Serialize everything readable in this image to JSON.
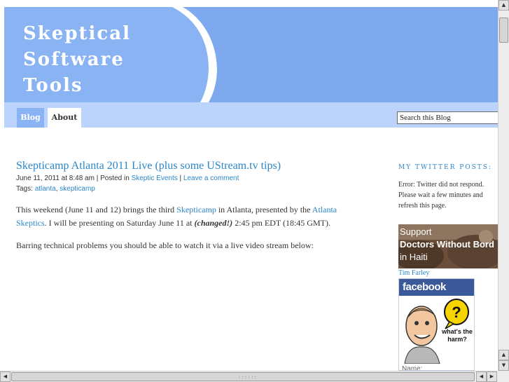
{
  "site": {
    "title": "Skeptical Software\nTools"
  },
  "nav": {
    "tabs": [
      "Blog",
      "About"
    ],
    "search_value": "Search this Blog"
  },
  "post": {
    "title": "Skepticamp Atlanta 2011 Live (plus some UStream.tv tips)",
    "date": "June 11, 2011 at 8:48 am",
    "posted_in_label": " | Posted in ",
    "category": "Skeptic Events",
    "sep": " | ",
    "comment_link": "Leave a comment",
    "tags_label": "Tags: ",
    "tags": [
      "atlanta",
      "skepticamp"
    ],
    "tags_sep": ", ",
    "p1_a": "This weekend (June 11 and 12) brings the third ",
    "p1_link1": "Skepticamp",
    "p1_b": " in Atlanta, presented by the ",
    "p1_link2": "Atlanta Skeptics",
    "p1_c": ". I will be presenting on Saturday June 11 at ",
    "p1_em": "(changed!)",
    "p1_d": " 2:45 pm EDT (18:45 GMT).",
    "p2": "Barring technical problems you should be able to watch it via a live video stream below:"
  },
  "sidebar": {
    "twitter_heading": "MY TWITTER POSTS:",
    "twitter_error": "Error: Twitter did not respond. Please wait a few minutes and refresh this page.",
    "haiti_line1": "Support",
    "haiti_line2": "Doctors Without Bord",
    "haiti_line3": "in Haiti",
    "badge_name": "Tim Farley",
    "fb_brand": "facebook",
    "fb_bubble": "what's the harm?",
    "fb_name_label": "Name:"
  },
  "scrollbar": {
    "up": "▲",
    "down": "▼",
    "left": "◀",
    "right": "▶",
    "grip": "::::::"
  },
  "colors": {
    "header_bg": "#8ab3f4",
    "nav_bg": "#bcd4fb",
    "link": "#2a86c8",
    "facebook": "#3b5998"
  }
}
